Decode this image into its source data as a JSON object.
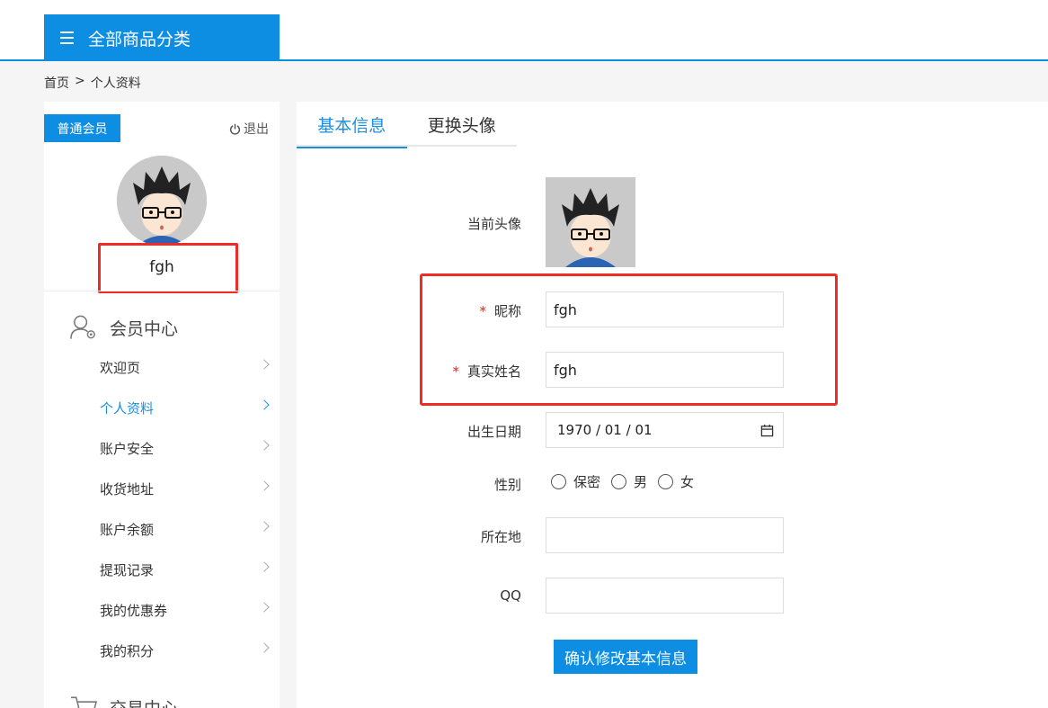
{
  "header": {
    "category_button": "全部商品分类"
  },
  "breadcrumb": {
    "home": "首页",
    "separator": ">",
    "current": "个人资料"
  },
  "sidebar": {
    "member_badge": "普通会员",
    "logout": "退出",
    "username": "fgh",
    "section1_title": "会员中心",
    "section2_title": "交易中心",
    "items": [
      {
        "label": "欢迎页"
      },
      {
        "label": "个人资料"
      },
      {
        "label": "账户安全"
      },
      {
        "label": "收货地址"
      },
      {
        "label": "账户余额"
      },
      {
        "label": "提现记录"
      },
      {
        "label": "我的优惠券"
      },
      {
        "label": "我的积分"
      }
    ],
    "active_item": "个人资料"
  },
  "tabs": [
    {
      "label": "基本信息"
    },
    {
      "label": "更换头像"
    }
  ],
  "active_tab": "基本信息",
  "form": {
    "avatar_label": "当前头像",
    "required_mark": "*",
    "nickname_label": "昵称",
    "nickname_value": "fgh",
    "realname_label": "真实姓名",
    "realname_value": "fgh",
    "birthday_label": "出生日期",
    "birthday_value": "1970 / 01 / 01",
    "gender_label": "性别",
    "gender_options": [
      "保密",
      "男",
      "女"
    ],
    "location_label": "所在地",
    "location_value": "",
    "qq_label": "QQ",
    "qq_value": "",
    "submit_label": "确认修改基本信息"
  },
  "colors": {
    "primary": "#0e8ee3",
    "highlight_box": "#ee2b24",
    "required": "#e6211a"
  }
}
